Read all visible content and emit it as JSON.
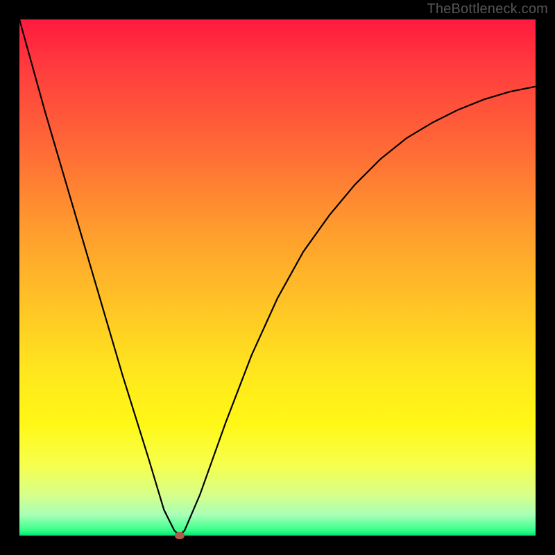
{
  "watermark": "TheBottleneck.com",
  "chart_data": {
    "type": "line",
    "title": "",
    "xlabel": "",
    "ylabel": "",
    "xlim": [
      0,
      100
    ],
    "ylim": [
      0,
      100
    ],
    "series": [
      {
        "name": "bottleneck-curve",
        "x": [
          0,
          5,
          10,
          15,
          20,
          25,
          28,
          30,
          31,
          32,
          35,
          40,
          45,
          50,
          55,
          60,
          65,
          70,
          75,
          80,
          85,
          90,
          95,
          100
        ],
        "values": [
          100,
          82,
          65,
          48,
          31,
          15,
          5,
          1,
          0,
          1,
          8,
          22,
          35,
          46,
          55,
          62,
          68,
          73,
          77,
          80,
          82.5,
          84.5,
          86,
          87
        ]
      }
    ],
    "annotations": [
      {
        "name": "optimal-point",
        "x": 31,
        "y": 0
      }
    ],
    "background_gradient": {
      "top": "#ff1a3e",
      "mid": "#ffe61e",
      "bottom": "#00e676"
    }
  }
}
